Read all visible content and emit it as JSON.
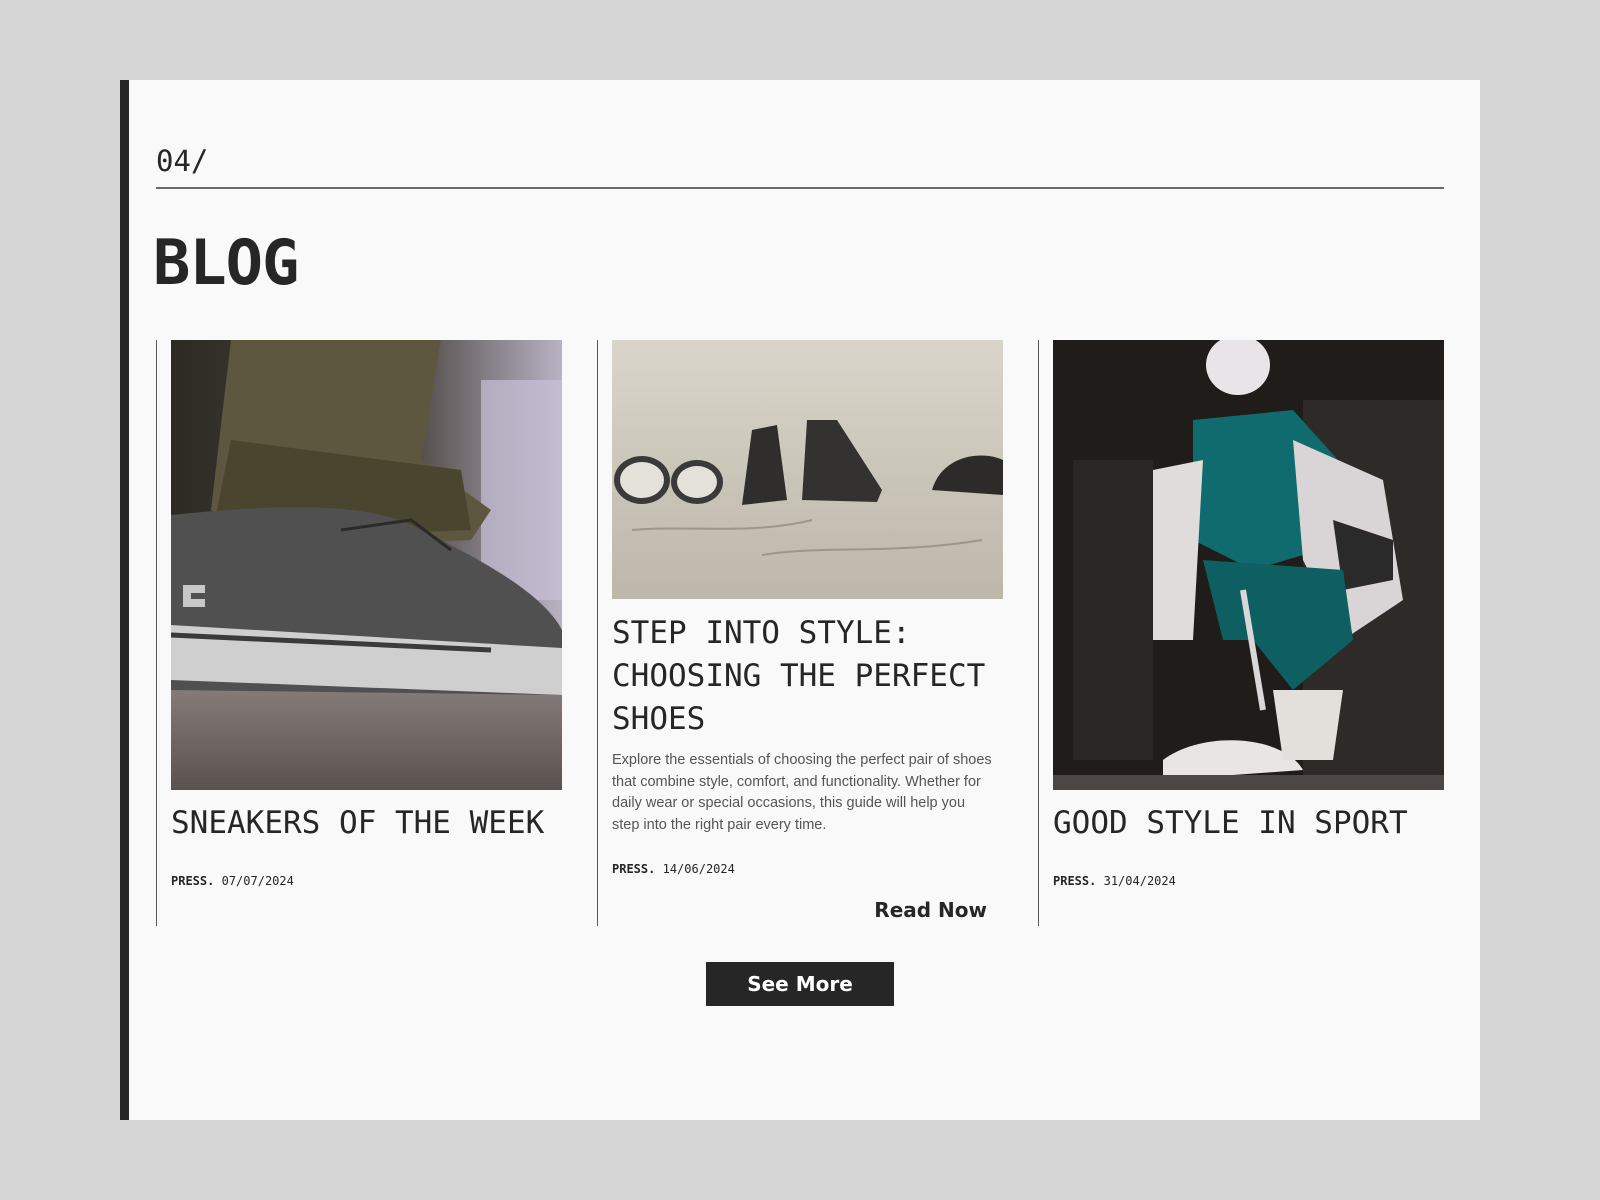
{
  "section": {
    "number": "04/",
    "title": "BLOG"
  },
  "posts": [
    {
      "title": "SNEAKERS OF THE WEEK",
      "excerpt": "",
      "press_label": "PRESS.",
      "date": "07/07/2024",
      "image": "grey-sneaker-closeup-photo"
    },
    {
      "title": "STEP INTO STYLE: CHOOSING THE PERFECT SHOES",
      "excerpt": "Explore the essentials of choosing the perfect pair of shoes that combine style, comfort, and functionality. Whether for daily wear or special occasions, this guide will help you step into the right pair every time.",
      "press_label": "PRESS.",
      "date": "14/06/2024",
      "read_label": "Read Now",
      "image": "shoes-on-sand-photo"
    },
    {
      "title": "GOOD STYLE IN SPORT",
      "excerpt": "",
      "press_label": "PRESS.",
      "date": "31/04/2024",
      "image": "sportswear-man-photo"
    }
  ],
  "see_more_label": "See More",
  "colors": {
    "background": "#d6d6d6",
    "panel": "#faf9f9",
    "ink": "#262626",
    "accent_teal": "#0f6b6e"
  }
}
